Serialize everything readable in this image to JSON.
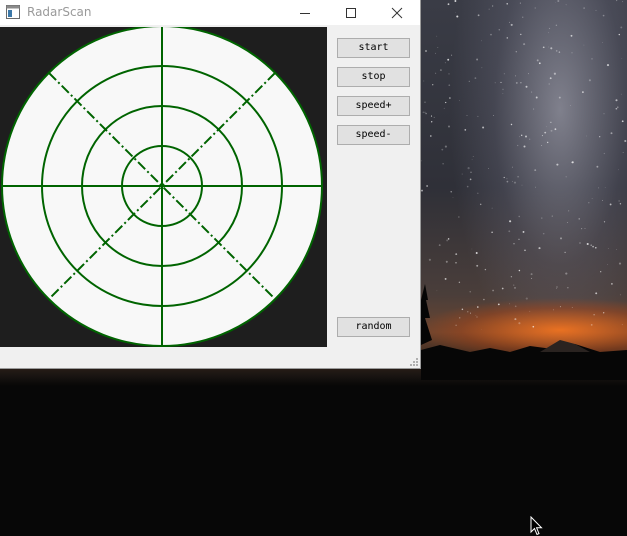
{
  "window": {
    "title": "RadarScan",
    "icon": "app-window-icon",
    "caption_buttons": [
      "minimize-icon",
      "maximize-icon",
      "close-icon"
    ]
  },
  "radar": {
    "background_color": "#1e1e1e",
    "face_color": "#f8f8f8",
    "line_color": "#006400",
    "rings": 4,
    "spokes": [
      "horizontal",
      "vertical",
      "diagonal-dashed",
      "diagonal-dashed"
    ]
  },
  "controls": {
    "start_label": "start",
    "stop_label": "stop",
    "speed_up_label": "speed+",
    "speed_down_label": "speed-",
    "random_label": "random"
  },
  "desktop": {
    "wallpaper": "milky-way-night-sky",
    "cursor": "arrow-cursor-icon"
  }
}
